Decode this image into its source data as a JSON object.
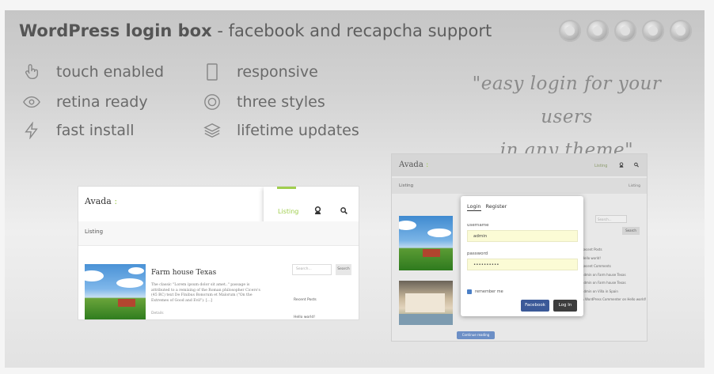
{
  "header": {
    "title_bold": "WordPress login box",
    "title_rest": " - facebook and recapcha support"
  },
  "browsers": [
    "chrome-icon",
    "firefox-icon",
    "ie-icon",
    "opera-icon",
    "safari-icon"
  ],
  "features": {
    "left": [
      {
        "icon": "hand-pointer-icon",
        "label": "touch enabled"
      },
      {
        "icon": "eye-icon",
        "label": "retina ready"
      },
      {
        "icon": "lightning-icon",
        "label": "fast install"
      }
    ],
    "right": [
      {
        "icon": "mobile-icon",
        "label": "responsive"
      },
      {
        "icon": "target-icon",
        "label": "three styles"
      },
      {
        "icon": "layers-icon",
        "label": "lifetime updates"
      }
    ]
  },
  "quote": {
    "line1": "\"easy login for your users",
    "line2": "in any theme\""
  },
  "shot1": {
    "logo": "Avada",
    "logo_accent": " :",
    "listing": "Listing",
    "subheader": "Listing",
    "post_title": "Farm house Texas",
    "post_text": "The classic \"Lorem ipsum dolor sit amet..\" passage is attributed to a remixing of the Roman philosopher Cicero's (45 BC) text De Finibus Bonorum et Malorum (\"On the Extremes of Good and Evil\"). [...]",
    "read_more": "Details",
    "search_placeholder": "Search...",
    "search_button": "Search",
    "sidebar_heading": "Recent Posts",
    "sidebar_link": "Hello world!"
  },
  "shot2": {
    "logo": "Avada",
    "logo_accent": " :",
    "listing": "Listing",
    "subheader_left": "Listing",
    "subheader_right": "Listing",
    "bottom_button": "Continue reading",
    "search_placeholder": "Search...",
    "search_button": "Search",
    "sidebar": [
      "Recent Posts",
      "Hello world!",
      "Recent Comments",
      "admin on Farm house Texas",
      "admin on Farm house Texas",
      "admin on Villa in Spain",
      "A WordPress Commenter on Hello world!"
    ],
    "modal": {
      "tab_login": "Login",
      "tab_register": "Register",
      "username_label": "username",
      "username_value": "admin",
      "password_label": "password",
      "password_value": "••••••••••",
      "remember_label": "remember me",
      "facebook_button": "Facebook",
      "login_button": "Log In"
    }
  }
}
